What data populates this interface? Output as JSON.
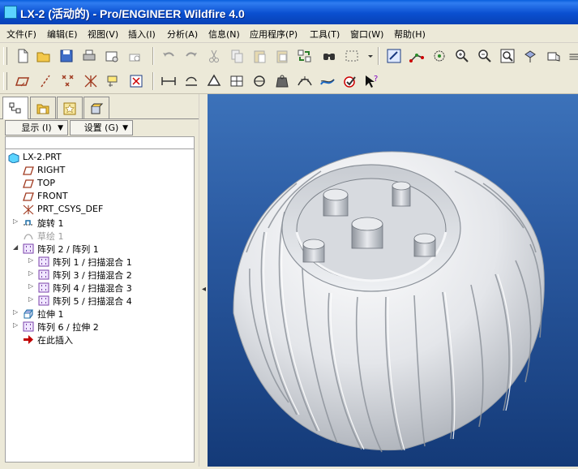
{
  "window": {
    "title": "LX-2 (活动的) - Pro/ENGINEER Wildfire 4.0"
  },
  "menu": [
    {
      "label": "文件(F)"
    },
    {
      "label": "编辑(E)"
    },
    {
      "label": "视图(V)"
    },
    {
      "label": "插入(I)"
    },
    {
      "label": "分析(A)"
    },
    {
      "label": "信息(N)"
    },
    {
      "label": "应用程序(P)"
    },
    {
      "label": "工具(T)"
    },
    {
      "label": "窗口(W)"
    },
    {
      "label": "帮助(H)"
    }
  ],
  "toolbar_icons": {
    "row1": [
      "new-file-icon",
      "open-folder-icon",
      "save-icon",
      "print-icon",
      "send-email-icon",
      "email-link-icon",
      "undo-icon",
      "redo-icon",
      "cut-icon",
      "copy-icon",
      "paste-icon",
      "paste-special-icon",
      "regenerate-icon",
      "find-icon",
      "select-box-icon",
      "repaint-icon",
      "spin-center-icon",
      "orient-icon",
      "zoom-in-icon",
      "zoom-out-icon",
      "refit-icon",
      "saved-view-icon",
      "layers-icon",
      "display-style-icon"
    ],
    "row2": [
      "datum-planes-icon",
      "datum-axes-icon",
      "datum-points-icon",
      "coordinate-systems-icon",
      "annotation-icon",
      "close-window-icon",
      "measure-distance-icon",
      "area-icon",
      "volume-icon",
      "section-icon",
      "diameter-icon",
      "mass-properties-icon",
      "curvature-icon",
      "analysis-icon",
      "model-check-icon",
      "whats-this-icon"
    ]
  },
  "navigator": {
    "show_button": "显示 (I)",
    "settings_button": "设置 (G)",
    "tree": [
      {
        "label": "LX-2.PRT"
      },
      {
        "label": "RIGHT"
      },
      {
        "label": "TOP"
      },
      {
        "label": "FRONT"
      },
      {
        "label": "PRT_CSYS_DEF"
      },
      {
        "label": "旋转 1"
      },
      {
        "label": "草绘 1"
      },
      {
        "label": "阵列 2 / 阵列 1"
      },
      {
        "label": "阵列 1 / 扫描混合 1"
      },
      {
        "label": "阵列 3 / 扫描混合 2"
      },
      {
        "label": "阵列 4 / 扫描混合 3"
      },
      {
        "label": "阵列 5 / 扫描混合 4"
      },
      {
        "label": "拉伸 1"
      },
      {
        "label": "阵列 6 / 拉伸 2"
      },
      {
        "label": "在此插入"
      }
    ]
  },
  "colors": {
    "titlebar": "#0a4fd0",
    "viewport_top": "#3c72ba",
    "viewport_bottom": "#143a78",
    "model": "#e4e6ea",
    "insert_arrow": "#c00000"
  }
}
